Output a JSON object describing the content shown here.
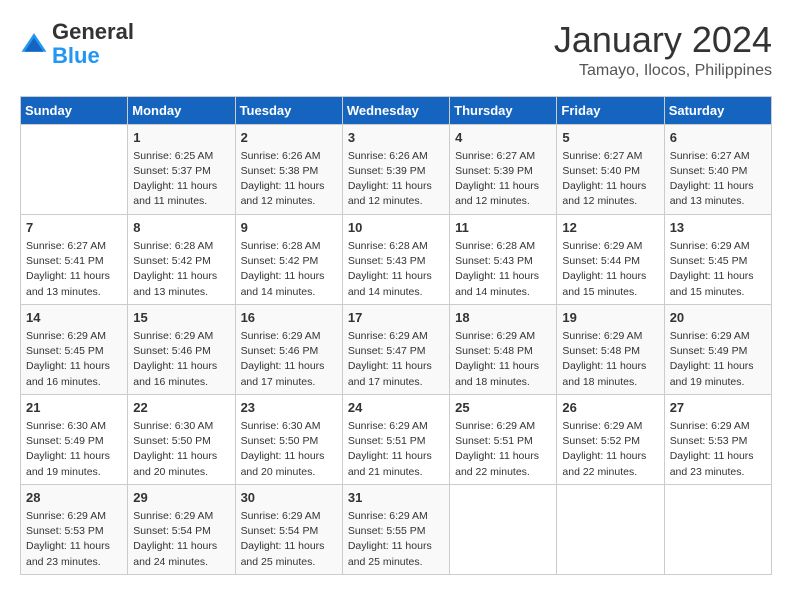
{
  "logo": {
    "general": "General",
    "blue": "Blue"
  },
  "title": "January 2024",
  "subtitle": "Tamayo, Ilocos, Philippines",
  "weekdays": [
    "Sunday",
    "Monday",
    "Tuesday",
    "Wednesday",
    "Thursday",
    "Friday",
    "Saturday"
  ],
  "weeks": [
    [
      {
        "day": "",
        "info": ""
      },
      {
        "day": "1",
        "info": "Sunrise: 6:25 AM\nSunset: 5:37 PM\nDaylight: 11 hours\nand 11 minutes."
      },
      {
        "day": "2",
        "info": "Sunrise: 6:26 AM\nSunset: 5:38 PM\nDaylight: 11 hours\nand 12 minutes."
      },
      {
        "day": "3",
        "info": "Sunrise: 6:26 AM\nSunset: 5:39 PM\nDaylight: 11 hours\nand 12 minutes."
      },
      {
        "day": "4",
        "info": "Sunrise: 6:27 AM\nSunset: 5:39 PM\nDaylight: 11 hours\nand 12 minutes."
      },
      {
        "day": "5",
        "info": "Sunrise: 6:27 AM\nSunset: 5:40 PM\nDaylight: 11 hours\nand 12 minutes."
      },
      {
        "day": "6",
        "info": "Sunrise: 6:27 AM\nSunset: 5:40 PM\nDaylight: 11 hours\nand 13 minutes."
      }
    ],
    [
      {
        "day": "7",
        "info": "Sunrise: 6:27 AM\nSunset: 5:41 PM\nDaylight: 11 hours\nand 13 minutes."
      },
      {
        "day": "8",
        "info": "Sunrise: 6:28 AM\nSunset: 5:42 PM\nDaylight: 11 hours\nand 13 minutes."
      },
      {
        "day": "9",
        "info": "Sunrise: 6:28 AM\nSunset: 5:42 PM\nDaylight: 11 hours\nand 14 minutes."
      },
      {
        "day": "10",
        "info": "Sunrise: 6:28 AM\nSunset: 5:43 PM\nDaylight: 11 hours\nand 14 minutes."
      },
      {
        "day": "11",
        "info": "Sunrise: 6:28 AM\nSunset: 5:43 PM\nDaylight: 11 hours\nand 14 minutes."
      },
      {
        "day": "12",
        "info": "Sunrise: 6:29 AM\nSunset: 5:44 PM\nDaylight: 11 hours\nand 15 minutes."
      },
      {
        "day": "13",
        "info": "Sunrise: 6:29 AM\nSunset: 5:45 PM\nDaylight: 11 hours\nand 15 minutes."
      }
    ],
    [
      {
        "day": "14",
        "info": "Sunrise: 6:29 AM\nSunset: 5:45 PM\nDaylight: 11 hours\nand 16 minutes."
      },
      {
        "day": "15",
        "info": "Sunrise: 6:29 AM\nSunset: 5:46 PM\nDaylight: 11 hours\nand 16 minutes."
      },
      {
        "day": "16",
        "info": "Sunrise: 6:29 AM\nSunset: 5:46 PM\nDaylight: 11 hours\nand 17 minutes."
      },
      {
        "day": "17",
        "info": "Sunrise: 6:29 AM\nSunset: 5:47 PM\nDaylight: 11 hours\nand 17 minutes."
      },
      {
        "day": "18",
        "info": "Sunrise: 6:29 AM\nSunset: 5:48 PM\nDaylight: 11 hours\nand 18 minutes."
      },
      {
        "day": "19",
        "info": "Sunrise: 6:29 AM\nSunset: 5:48 PM\nDaylight: 11 hours\nand 18 minutes."
      },
      {
        "day": "20",
        "info": "Sunrise: 6:29 AM\nSunset: 5:49 PM\nDaylight: 11 hours\nand 19 minutes."
      }
    ],
    [
      {
        "day": "21",
        "info": "Sunrise: 6:30 AM\nSunset: 5:49 PM\nDaylight: 11 hours\nand 19 minutes."
      },
      {
        "day": "22",
        "info": "Sunrise: 6:30 AM\nSunset: 5:50 PM\nDaylight: 11 hours\nand 20 minutes."
      },
      {
        "day": "23",
        "info": "Sunrise: 6:30 AM\nSunset: 5:50 PM\nDaylight: 11 hours\nand 20 minutes."
      },
      {
        "day": "24",
        "info": "Sunrise: 6:29 AM\nSunset: 5:51 PM\nDaylight: 11 hours\nand 21 minutes."
      },
      {
        "day": "25",
        "info": "Sunrise: 6:29 AM\nSunset: 5:51 PM\nDaylight: 11 hours\nand 22 minutes."
      },
      {
        "day": "26",
        "info": "Sunrise: 6:29 AM\nSunset: 5:52 PM\nDaylight: 11 hours\nand 22 minutes."
      },
      {
        "day": "27",
        "info": "Sunrise: 6:29 AM\nSunset: 5:53 PM\nDaylight: 11 hours\nand 23 minutes."
      }
    ],
    [
      {
        "day": "28",
        "info": "Sunrise: 6:29 AM\nSunset: 5:53 PM\nDaylight: 11 hours\nand 23 minutes."
      },
      {
        "day": "29",
        "info": "Sunrise: 6:29 AM\nSunset: 5:54 PM\nDaylight: 11 hours\nand 24 minutes."
      },
      {
        "day": "30",
        "info": "Sunrise: 6:29 AM\nSunset: 5:54 PM\nDaylight: 11 hours\nand 25 minutes."
      },
      {
        "day": "31",
        "info": "Sunrise: 6:29 AM\nSunset: 5:55 PM\nDaylight: 11 hours\nand 25 minutes."
      },
      {
        "day": "",
        "info": ""
      },
      {
        "day": "",
        "info": ""
      },
      {
        "day": "",
        "info": ""
      }
    ]
  ]
}
